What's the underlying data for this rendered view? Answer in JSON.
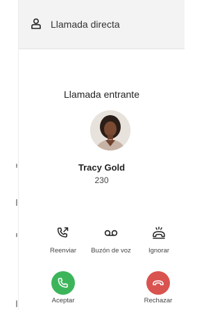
{
  "header": {
    "title": "Llamada directa",
    "icon": "user-icon"
  },
  "call": {
    "status": "Llamada entrante",
    "caller_name": "Tracy Gold",
    "caller_number": "230"
  },
  "actions": [
    {
      "label": "Reenviar",
      "icon": "phone-forward-icon"
    },
    {
      "label": "Buzón de voz",
      "icon": "voicemail-icon"
    },
    {
      "label": "Ignorar",
      "icon": "bell-ringing-off-icon"
    }
  ],
  "buttons": {
    "accept": {
      "label": "Aceptar",
      "color": "#3cb55a",
      "icon": "phone-icon"
    },
    "reject": {
      "label": "Rechazar",
      "color": "#d9534f",
      "icon": "hangup-icon"
    }
  }
}
